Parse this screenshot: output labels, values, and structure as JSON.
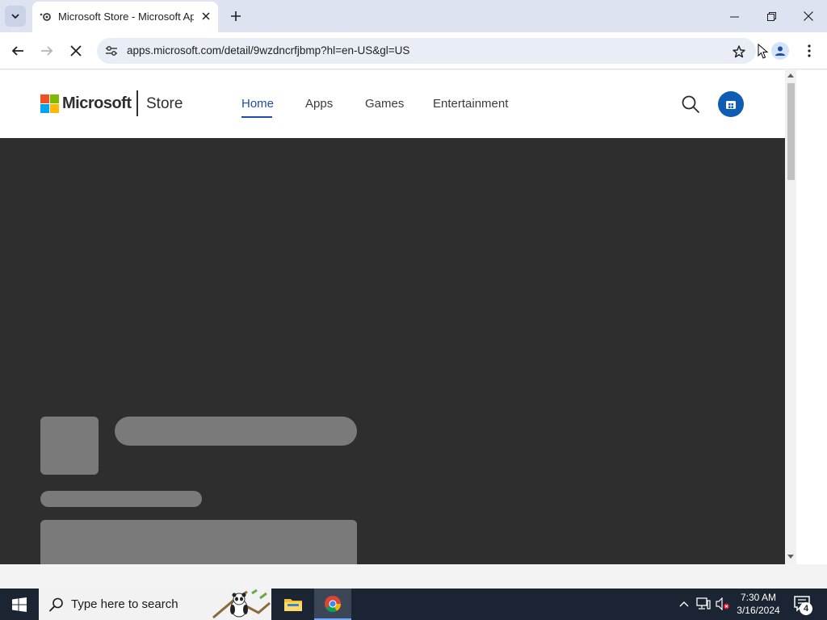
{
  "browser": {
    "tab": {
      "title": "Microsoft Store - Microsoft App",
      "favicon": "loading-favicon-icon"
    },
    "new_tab_icon": "plus-icon",
    "window_controls": [
      "minimize-icon",
      "restore-icon",
      "close-icon"
    ],
    "address": {
      "url": "apps.microsoft.com/detail/9wzdncrfjbmp?hl=en-US&gl=US"
    }
  },
  "store": {
    "brand": "Microsoft",
    "product": "Store",
    "nav": [
      {
        "label": "Home",
        "active": true
      },
      {
        "label": "Apps",
        "active": false
      },
      {
        "label": "Games",
        "active": false
      },
      {
        "label": "Entertainment",
        "active": false
      }
    ],
    "accent": "#1a4fa3",
    "hero_background": "#2e2e2e",
    "skeleton_color": "#7a7a7a"
  },
  "taskbar": {
    "search_placeholder": "Type here to search",
    "apps": [
      "file-explorer-icon",
      "chrome-icon"
    ],
    "clock": {
      "time": "7:30 AM",
      "date": "3/16/2024"
    },
    "notification_count": "4"
  }
}
